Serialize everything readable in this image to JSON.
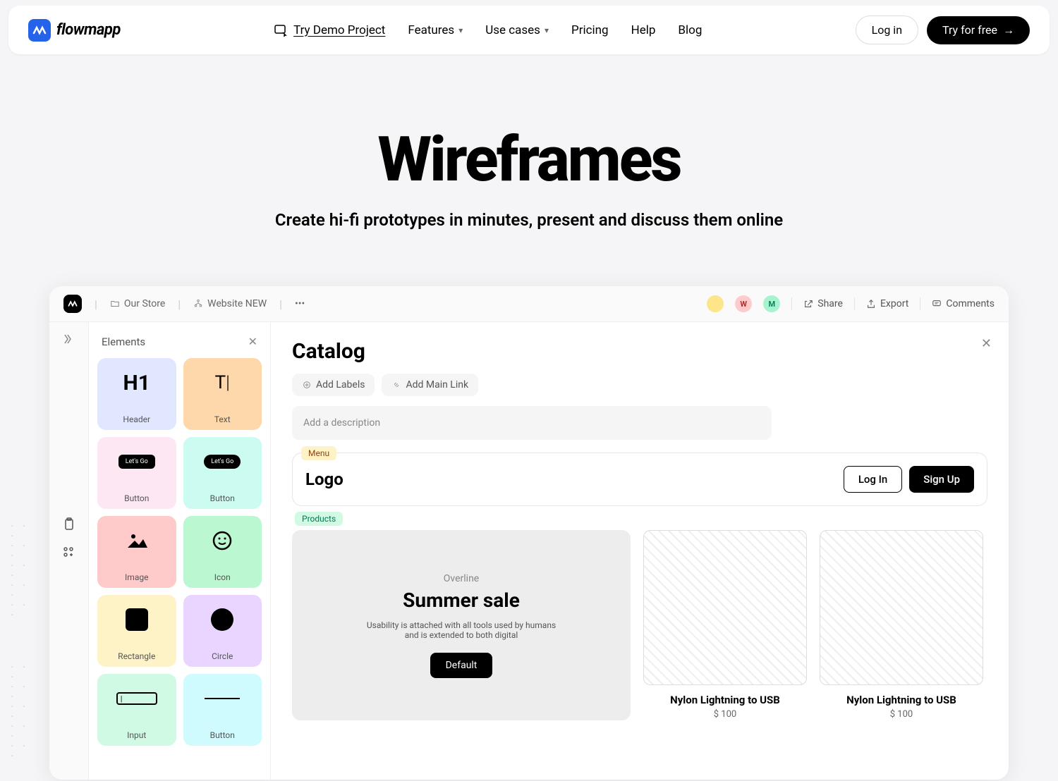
{
  "nav": {
    "brand": "flowmapp",
    "demo": "Try Demo Project",
    "features": "Features",
    "usecases": "Use cases",
    "pricing": "Pricing",
    "help": "Help",
    "blog": "Blog",
    "login": "Log in",
    "tryfree": "Try for free"
  },
  "hero": {
    "title": "Wireframes",
    "sub": "Create hi-fi prototypes in minutes, present and discuss them online"
  },
  "app": {
    "crumb1": "Our Store",
    "crumb2": "Website NEW",
    "av2": "W",
    "av3": "M",
    "share": "Share",
    "export": "Export",
    "comments": "Comments"
  },
  "side": {
    "title": "Elements",
    "header": "Header",
    "text": "Text",
    "button": "Button",
    "image": "Image",
    "icon": "Icon",
    "rectangle": "Rectangle",
    "circle": "Circle",
    "input": "Input",
    "h1": "H1",
    "t": "T",
    "letsgo": "Let's Go"
  },
  "canvas": {
    "title": "Catalog",
    "addlabels": "Add Labels",
    "addmainlink": "Add Main Link",
    "descplaceholder": "Add a description",
    "menu_tag": "Menu",
    "products_tag": "Products",
    "logo": "Logo",
    "login": "Log In",
    "signup": "Sign Up",
    "overline": "Overline",
    "hero_h": "Summer sale",
    "hero_p": "Usability is attached with all tools used by humans and is extended to both digital",
    "default": "Default",
    "prod1_name": "Nylon Lightning to USB",
    "prod1_price": "$ 100",
    "prod2_name": "Nylon Lightning to USB",
    "prod2_price": "$ 100"
  }
}
